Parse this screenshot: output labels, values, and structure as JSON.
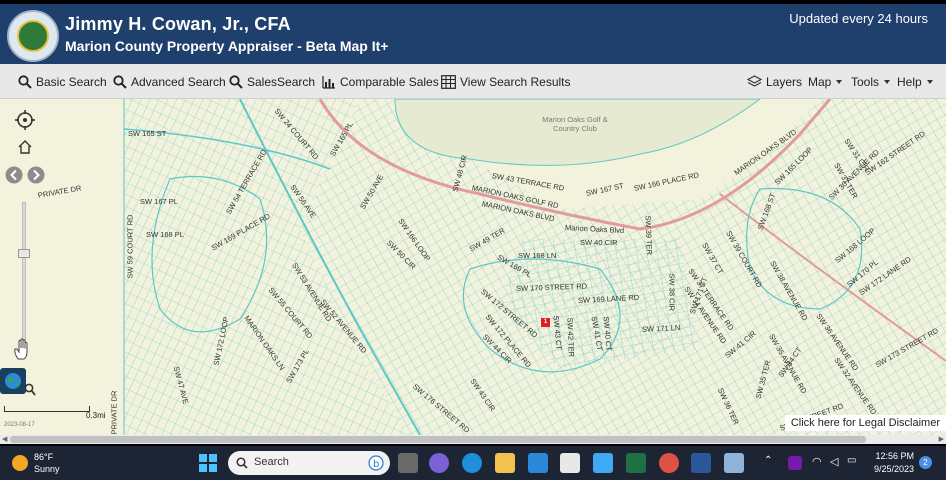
{
  "header": {
    "title": "Jimmy H. Cowan, Jr., CFA",
    "subtitle": "Marion County Property Appraiser - Beta Map It+",
    "updated": "Updated every 24 hours",
    "seal_text": "PROPERTY APPRAISER"
  },
  "toolbar": {
    "basic_search": "Basic Search",
    "advanced_search": "Advanced Search",
    "sales_search": "SalesSearch",
    "comparable_sales": "Comparable Sales",
    "view_results": "View Search Results",
    "layers": "Layers",
    "map": "Map",
    "tools": "Tools",
    "help": "Help"
  },
  "map": {
    "golf_label": "Marion Oaks Golf & Country Club",
    "scale_label": "0.3mi",
    "scale_date": "2023-08-17",
    "disclaimer": "Click here for Legal Disclaimer",
    "parcel_marker": "1",
    "streets": [
      "SW 165 ST",
      "SW 24 COURT RD",
      "SW 165 PL",
      "PRIVATE DR",
      "SW 167 PL",
      "SW 168 PL",
      "SW 54 TERRACE RD",
      "SW 169 PLACE RD",
      "SW 56 AVE",
      "SW 59 COURT RD",
      "SW 53 AVENUE RD",
      "SW 55 COURT RD",
      "SW 52 AVENUE RD",
      "MARION OAKS LN",
      "SW 173 PL",
      "SW 47 AVE",
      "SW 172 LOOP",
      "PRIVATE DR",
      "SW 50 AVE",
      "SW 48 CIR",
      "SW 43 TERRACE RD",
      "MARION OAKS GOLF RD",
      "MARION OAKS BLVD",
      "SW 166 LOOP",
      "SW 50 CIR",
      "SW 49 TER",
      "SW 169 PL",
      "SW 168 LN",
      "Marion Oaks Blvd",
      "SW 167 ST",
      "SW 166 PLACE RD",
      "SW 39 TER",
      "SW 40 CIR",
      "SW 170 STREET RD",
      "SW 169 LANE RD",
      "SW 172 STREET RD",
      "SW 172 PLACE RD",
      "SW 44 CIR",
      "SW 43 CT",
      "SW 42 TER",
      "SW 40 CT",
      "SW 41 CT",
      "SW 171 LN",
      "SW 38 CIR",
      "SW 37 CT",
      "SW 37 TERRACE RD",
      "SW 34 AVENUE RD",
      "SW 171 ST",
      "SW 39 COURT RD",
      "SW 168 ST",
      "SW 38 AVENUE RD",
      "MARION OAKS BLVD",
      "SW 165 LOOP",
      "SW 31 CIR",
      "SW 31 TER",
      "SW 162 STREET RD",
      "SW 30 AVENUE RD",
      "SW 168 LOOP",
      "SW 170 PL",
      "SW 172 LANE RD",
      "SW 173 STREET RD",
      "SW 36 AVENUE RD",
      "SW 41 CIR",
      "SW 35 AVENUE RD",
      "SW 34 CT",
      "SW 35 TER",
      "SW 36 TER",
      "SW 176 STREET RD",
      "SW 43 CIR",
      "SW 32 AVENUE RD",
      "SW 18 STREET RD"
    ]
  },
  "taskbar": {
    "temperature": "86°F",
    "condition": "Sunny",
    "search_placeholder": "Search",
    "time": "12:56 PM",
    "date": "9/25/2023",
    "notification_count": "2"
  },
  "colors": {
    "header_bg": "#1f3f6d",
    "map_bg": "#f3f2dc",
    "parcel_lines": "#5ec7c7",
    "road_line": "#e29b9b",
    "parcel_marker": "#e02020"
  }
}
